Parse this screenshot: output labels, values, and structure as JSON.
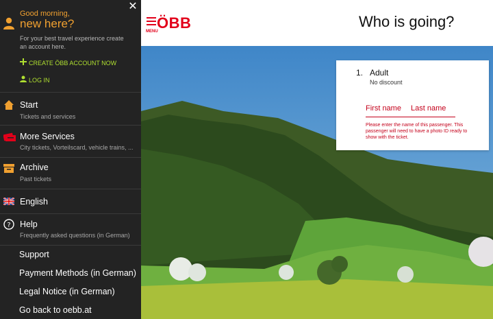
{
  "sidebar": {
    "greeting_small": "Good morning,",
    "greeting_big": "new here?",
    "greeting_desc": "For your best travel experience create an account here.",
    "create_account": "CREATE ÖBB ACCOUNT NOW",
    "log_in": "LOG IN",
    "nav": [
      {
        "title": "Start",
        "sub": "Tickets and services",
        "icon": "home-icon"
      },
      {
        "title": "More Services",
        "sub": "City tickets, Vorteilscard, vehicle trains, ...",
        "icon": "tickets-icon"
      },
      {
        "title": "Archive",
        "sub": "Past tickets",
        "icon": "archive-icon"
      },
      {
        "title": "English",
        "sub": "",
        "icon": "uk-flag-icon"
      },
      {
        "title": "Help",
        "sub": "Frequently asked questions (in German)",
        "icon": "help-icon"
      }
    ],
    "links": [
      "Support",
      "Payment Methods (in German)",
      "Legal Notice (in German)",
      "Go back to oebb.at"
    ]
  },
  "header": {
    "menu_label": "MENU",
    "logo": "ÖBB",
    "title": "Who is going?"
  },
  "passenger": {
    "number": "1.",
    "type": "Adult",
    "discount": "No discount",
    "first_name_placeholder": "First name",
    "last_name_placeholder": "Last name",
    "error": "Please enter the name of this passenger. This passenger will need to have a photo ID ready to show with the ticket."
  },
  "colors": {
    "brand_red": "#e2001a",
    "accent_orange": "#f0a030",
    "accent_green": "#b0e030",
    "sidebar_bg": "#232323"
  }
}
